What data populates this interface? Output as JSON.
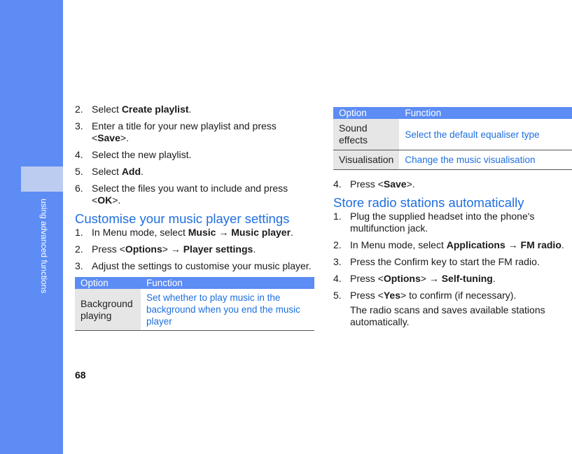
{
  "page": {
    "number": "68",
    "section_label": "using advanced functions"
  },
  "left": {
    "steps_top": [
      {
        "num": "2.",
        "before": "Select ",
        "bold": "Create playlist",
        "after": "."
      },
      {
        "num": "3.",
        "before": "Enter a title for your new playlist and press <",
        "bold": "Save",
        "after": ">."
      },
      {
        "num": "4.",
        "before": "Select the new playlist.",
        "bold": "",
        "after": ""
      },
      {
        "num": "5.",
        "before": "Select ",
        "bold": "Add",
        "after": "."
      },
      {
        "num": "6.",
        "before": "Select the files you want to include and press <",
        "bold": "OK",
        "after": ">."
      }
    ],
    "heading": "Customise your music player settings",
    "steps_bottom": [
      {
        "num": "1.",
        "t1": "In Menu mode, select ",
        "b1": "Music",
        "t2": " → ",
        "b2": "Music player",
        "t3": "."
      },
      {
        "num": "2.",
        "t1": "Press <",
        "b1": "Options",
        "t2": "> → ",
        "b2": "Player settings",
        "t3": "."
      },
      {
        "num": "3.",
        "t1": "Adjust the settings to customise your music player.",
        "b1": "",
        "t2": "",
        "b2": "",
        "t3": ""
      }
    ],
    "table": {
      "col_option": "Option",
      "col_function": "Function",
      "rows": [
        {
          "option": "Background playing",
          "function": "Set whether to play music in the background when you end the music player"
        }
      ]
    }
  },
  "right": {
    "table": {
      "col_option": "Option",
      "col_function": "Function",
      "rows": [
        {
          "option": "Sound effects",
          "function": "Select the default equaliser type"
        },
        {
          "option": "Visualisation",
          "function": "Change the music visualisation"
        }
      ]
    },
    "step4": {
      "num": "4.",
      "before": "Press <",
      "bold": "Save",
      "after": ">."
    },
    "heading": "Store radio stations automatically",
    "steps": [
      {
        "num": "1.",
        "t1": "Plug the supplied headset into the phone's multifunction jack.",
        "b1": "",
        "t2": "",
        "b2": "",
        "t3": ""
      },
      {
        "num": "2.",
        "t1": "In Menu mode, select ",
        "b1": "Applications",
        "t2": " → ",
        "b2": "FM radio",
        "t3": "."
      },
      {
        "num": "3.",
        "t1": "Press the Confirm key to start the FM radio.",
        "b1": "",
        "t2": "",
        "b2": "",
        "t3": ""
      },
      {
        "num": "4.",
        "t1": "Press <",
        "b1": "Options",
        "t2": "> → ",
        "b2": "Self-tuning",
        "t3": "."
      },
      {
        "num": "5.",
        "t1": "Press <",
        "b1": "Yes",
        "t2": "> to confirm (if necessary).",
        "b2": "",
        "t3": ""
      }
    ],
    "note": "The radio scans and saves available stations automatically."
  }
}
